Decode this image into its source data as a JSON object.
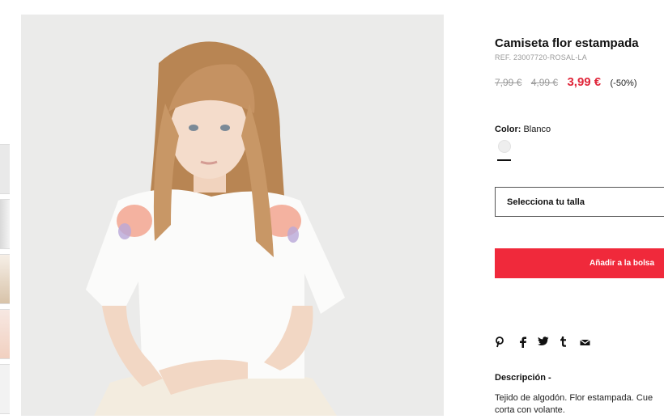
{
  "product": {
    "title": "Camiseta flor estampada",
    "ref": "REF. 23007720-ROSAL-LA",
    "prices": {
      "original": "7,99 €",
      "previous": "4,99 €",
      "current": "3,99 €",
      "discount": "(-50%)"
    },
    "color": {
      "label": "Color:",
      "value": "Blanco",
      "swatch_hex": "#eeeeee"
    },
    "size_select": {
      "label": "Selecciona tu talla"
    },
    "add_button": {
      "label": "Añadir a la bolsa"
    },
    "share_icons": [
      "pinterest-icon",
      "facebook-icon",
      "twitter-icon",
      "tumblr-icon",
      "email-icon"
    ],
    "description": {
      "heading": "Descripción -",
      "text": "Tejido de algodón. Flor estampada. Cue corta con volante."
    }
  },
  "gallery": {
    "thumbnail_count": 5,
    "main_image_alt": "product-photo"
  },
  "colors": {
    "accent": "#f0293b",
    "price_red": "#e0263a",
    "muted": "#9a9a9a"
  }
}
